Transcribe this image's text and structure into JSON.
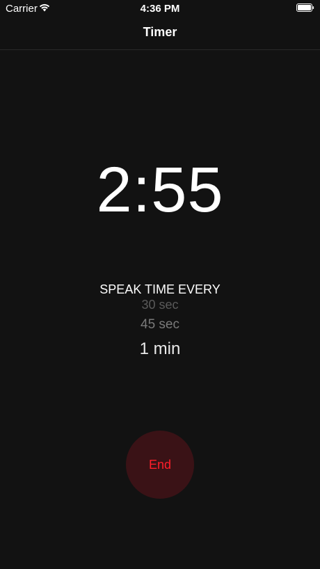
{
  "status_bar": {
    "carrier": "Carrier",
    "time": "4:36 PM",
    "icons": [
      "wifi-icon",
      "battery-icon"
    ]
  },
  "nav": {
    "title": "Timer"
  },
  "timer": {
    "display": "2:55"
  },
  "speak": {
    "label": "SPEAK TIME EVERY",
    "options": [
      "30 sec",
      "45 sec",
      "1 min"
    ],
    "selected": "1 min"
  },
  "actions": {
    "end_label": "End"
  },
  "colors": {
    "background": "#121212",
    "end_button_bg": "#3a1216",
    "end_button_text": "#ff1e2a"
  }
}
